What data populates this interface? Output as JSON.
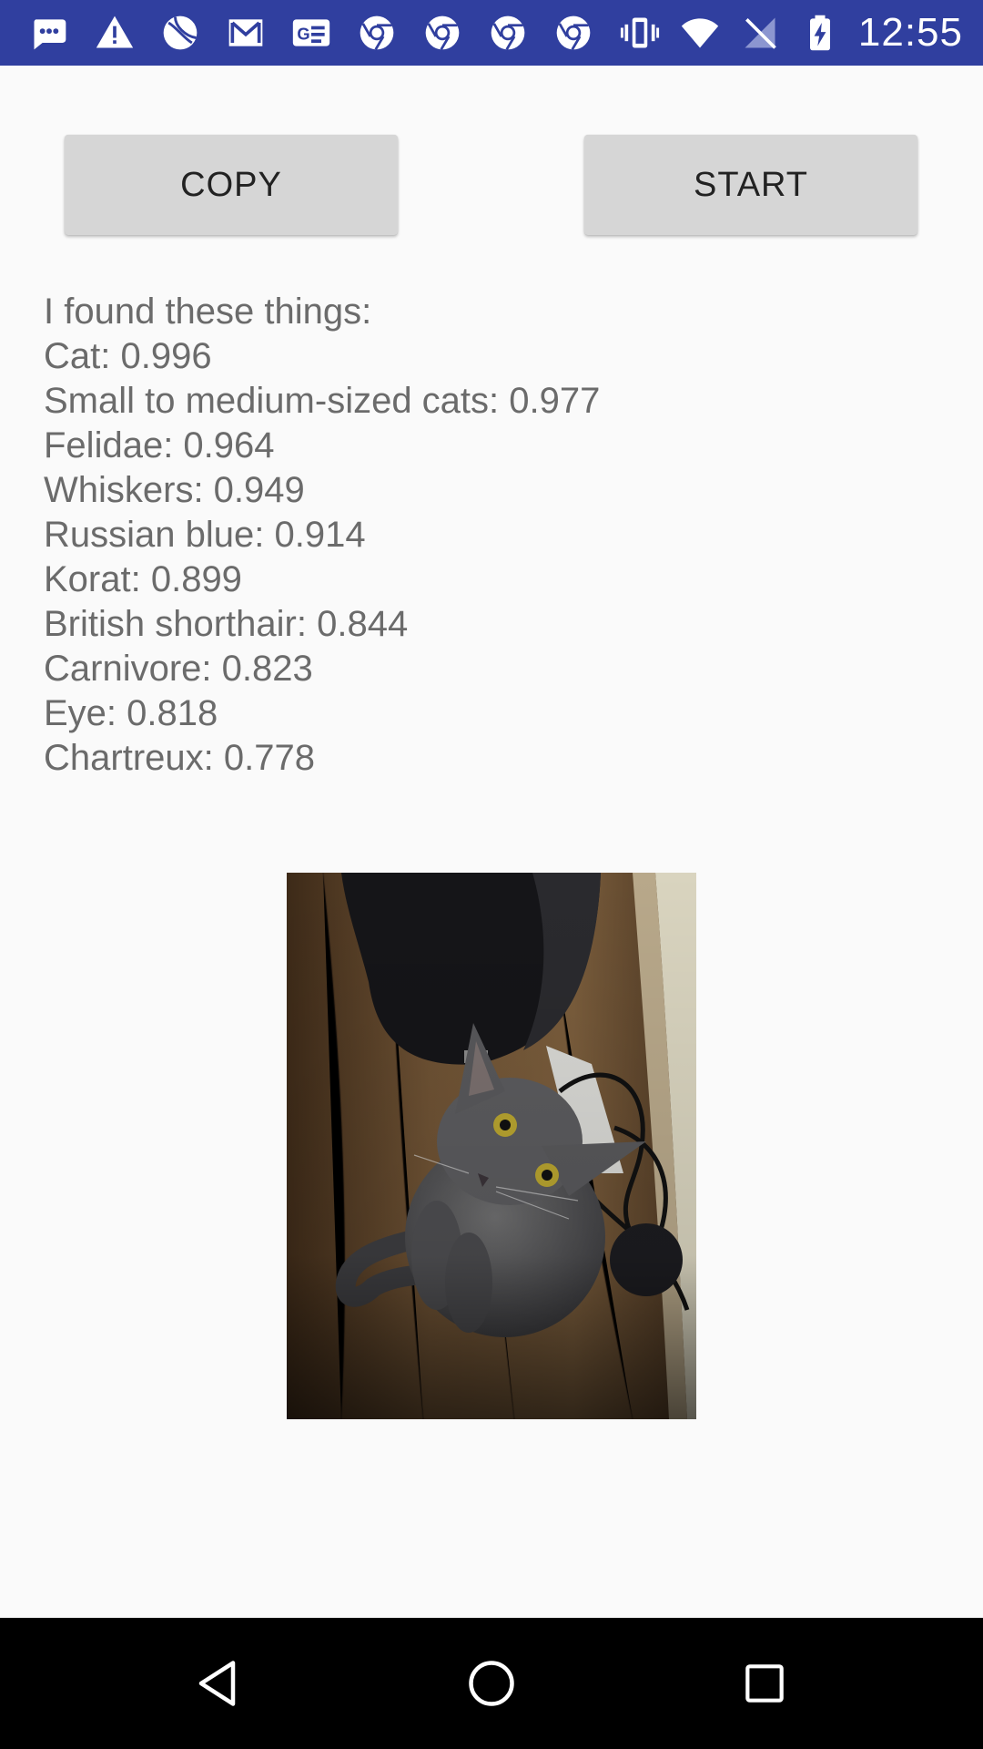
{
  "status_bar": {
    "time": "12:55",
    "background": "#303f9f",
    "left_icons": [
      "messages-icon",
      "warning-icon",
      "sports-icon",
      "gmail-icon",
      "news-icon",
      "chrome-icon",
      "chrome-icon",
      "chrome-icon",
      "chrome-icon"
    ],
    "right_icons": [
      "vibrate-icon",
      "wifi-icon",
      "no-signal-icon",
      "battery-charging-icon"
    ]
  },
  "buttons": {
    "copy_label": "COPY",
    "start_label": "START"
  },
  "results": {
    "heading": "I found these things:",
    "items": [
      "Cat: 0.996",
      "Small to medium-sized cats: 0.977",
      "Felidae: 0.964",
      "Whiskers: 0.949",
      "Russian blue: 0.914",
      "Korat: 0.899",
      "British shorthair: 0.844",
      "Carnivore: 0.823",
      "Eye: 0.818",
      "Chartreux: 0.778"
    ]
  },
  "image": {
    "subject": "gray-cat-photo"
  },
  "nav_bar": {
    "icons": [
      "back-icon",
      "home-icon",
      "recents-icon"
    ]
  }
}
